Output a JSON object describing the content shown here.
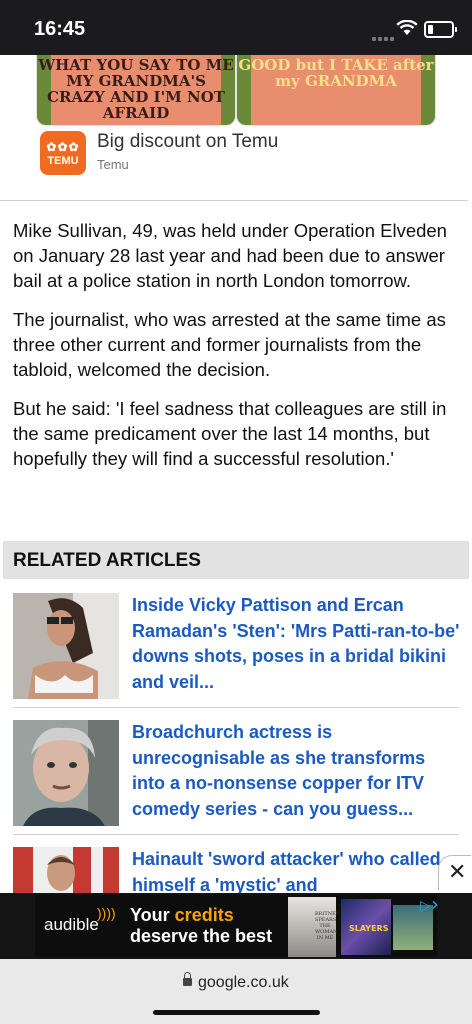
{
  "status_bar": {
    "time": "16:45"
  },
  "ad_card": {
    "image1_text": "WHAT YOU SAY TO ME MY GRANDMA'S CRAZY AND I'M NOT AFRAID",
    "image2_text": "GOOD but I TAKE after my GRANDMA",
    "logo_text": "TEMU",
    "title": "Big discount on Temu",
    "source": "Temu"
  },
  "article": {
    "paragraphs": [
      "Mike Sullivan, 49, was held under Operation Elveden on January 28 last year and had been due to answer bail at a police station in north London tomorrow.",
      "The journalist, who was arrested at the same time as three other current and former journalists from the tabloid, welcomed the decision.",
      "But he said: 'I feel sadness that colleagues are still in the same predicament over the last 14 months, but hopefully they will find a successful resolution.'"
    ]
  },
  "related": {
    "heading": "RELATED ARTICLES",
    "items": [
      {
        "title": "Inside Vicky Pattison and Ercan Ramadan's 'Sten': 'Mrs Patti-ran-to-be' downs shots, poses in a bridal bikini and veil..."
      },
      {
        "title": "Broadchurch actress is unrecognisable as she transforms into a no-nonsense copper for ITV comedy series - can you guess..."
      },
      {
        "title": "Hainault 'sword attacker' who called himself a 'mystic' and"
      }
    ]
  },
  "banner_ad": {
    "brand": "audible",
    "line1_prefix": "Your ",
    "line1_accent": "credits",
    "line2": "deserve the best",
    "book1_text": "BRITNEY SPEARS THE WOMAN IN ME",
    "book2_text": "SLAYERS",
    "accent_color": "#f7a400"
  },
  "browser": {
    "url": "google.co.uk"
  },
  "colors": {
    "link": "#1a5ac2",
    "temu": "#f06b1f"
  }
}
